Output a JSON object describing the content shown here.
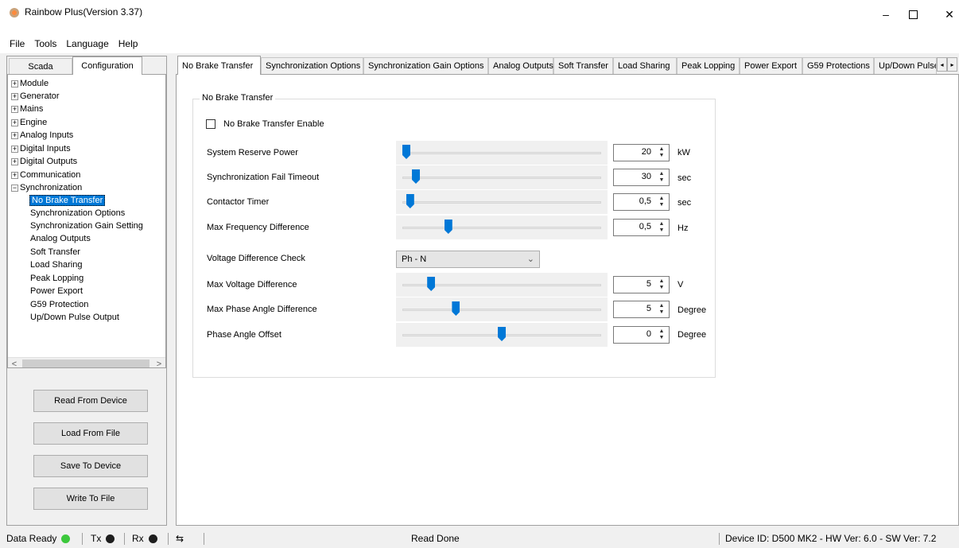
{
  "window": {
    "title": "Rainbow Plus(Version 3.37)",
    "min_symbol": "–",
    "close_symbol": "✕"
  },
  "menu": [
    "File",
    "Tools",
    "Language",
    "Help"
  ],
  "left_tabs": [
    "Scada",
    "Configuration"
  ],
  "tree": {
    "top_level": [
      "Module",
      "Generator",
      "Mains",
      "Engine",
      "Analog Inputs",
      "Digital Inputs",
      "Digital Outputs",
      "Communication",
      "Synchronization"
    ],
    "children": [
      "No Brake Transfer",
      "Synchronization Options",
      "Synchronization Gain Setting",
      "Analog Outputs",
      "Soft Transfer",
      "Load Sharing",
      "Peak Lopping",
      "Power Export",
      "G59 Protection",
      "Up/Down Pulse Output"
    ],
    "selected": "No Brake Transfer",
    "collapsed_symbol": "+",
    "expanded_symbol": "−",
    "scroll_left": "<",
    "scroll_right": ">"
  },
  "buttons": {
    "read": "Read From Device",
    "load": "Load From File",
    "save": "Save To Device",
    "write": "Write To File"
  },
  "tabs": [
    "No Brake Transfer",
    "Synchronization Options",
    "Synchronization Gain Options",
    "Analog Outputs",
    "Soft Transfer",
    "Load Sharing",
    "Peak Lopping",
    "Power Export",
    "G59 Protections",
    "Up/Down Pulse"
  ],
  "tab_scroll": {
    "left": "◂",
    "right": "▸"
  },
  "panel": {
    "group_title": "No Brake Transfer",
    "enable_label": "No Brake Transfer Enable",
    "enable_checked": false,
    "spin_up": "▲",
    "spin_down": "▼",
    "fields": [
      {
        "label": "System Reserve Power",
        "value": "20",
        "unit": "kW",
        "slider_fraction": 0.0
      },
      {
        "label": "Synchronization Fail Timeout",
        "value": "30",
        "unit": "sec",
        "slider_fraction": 0.05
      },
      {
        "label": "Contactor Timer",
        "value": "0,5",
        "unit": "sec",
        "slider_fraction": 0.02
      },
      {
        "label": "Max Frequency Difference",
        "value": "0,5",
        "unit": "Hz",
        "slider_fraction": 0.22
      }
    ],
    "voltage_check": {
      "label": "Voltage Difference Check",
      "value": "Ph - N",
      "arrow": "⌄"
    },
    "fields2": [
      {
        "label": "Max Voltage Difference",
        "value": "5",
        "unit": "V",
        "slider_fraction": 0.13
      },
      {
        "label": "Max Phase Angle Difference",
        "value": "5",
        "unit": "Degree",
        "slider_fraction": 0.26
      },
      {
        "label": "Phase Angle Offset",
        "value": "0",
        "unit": "Degree",
        "slider_fraction": 0.5
      }
    ]
  },
  "status": {
    "data_ready": "Data Ready",
    "tx": "Tx",
    "rx": "Rx",
    "usb_symbol": "⇆",
    "message": "Read Done",
    "device": "Device ID: D500 MK2 - HW Ver: 6.0 - SW Ver: 7.2",
    "colors": {
      "data_ready": "#3cc83c",
      "tx": "#1e1e1e",
      "rx": "#1e1e1e"
    }
  }
}
